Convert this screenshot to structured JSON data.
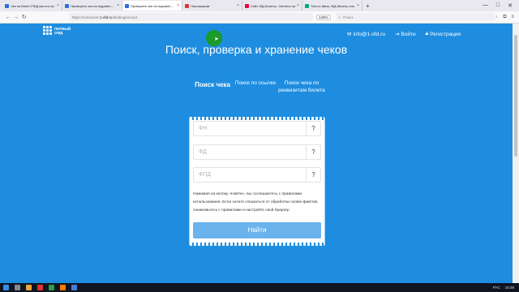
{
  "browser": {
    "tabs": [
      {
        "label": "Чек на билет РЖД как его на",
        "color": "#2a6fdb"
      },
      {
        "label": "Проверить чек на подлинность",
        "color": "#2a6fdb"
      },
      {
        "label": "Проверить чек на подлинность н",
        "color": "#2a6fdb",
        "active": true
      },
      {
        "label": "Пассажирам",
        "color": "#d33"
      },
      {
        "label": "Сайт ЖД Билеты - Билеты на",
        "color": "#e04"
      },
      {
        "label": "Tutu.ru Авиа, ЖД билеты онл",
        "color": "#0a7"
      }
    ],
    "new_tab": "+",
    "window_controls": [
      "—",
      "□",
      "✕"
    ],
    "url_prefix": "https://consumer.",
    "url_domain": "1-ofd.ru",
    "url_path": "/landing/receipt",
    "zoom": "140%",
    "search_placeholder": "Поиск"
  },
  "site": {
    "logo_line1": "ПЕРВЫЙ",
    "logo_line2": "ОФД",
    "nav": {
      "email": "info@1-ofd.ru",
      "login": "Войти",
      "register": "Регистрация"
    },
    "title": "Поиск, проверка и хранение чеков",
    "modes": [
      {
        "label": "Поиск чека",
        "active": true
      },
      {
        "label": "Поиск по ссылке"
      },
      {
        "label": "Поиск чека по реквизитам билета"
      }
    ],
    "form": {
      "fn_placeholder": "ФН",
      "fd_placeholder": "ФД",
      "fpd_placeholder": "ФПД",
      "help": "?",
      "notice": "Нажимая на кнопку «Найти», вы соглашаетесь с правилами использования. Если хотите отказаться от обработки cookie-файлов, ознакомьтесь с правилами и настройте свой браузер",
      "submit": "Найти"
    }
  },
  "taskbar": {
    "lang": "РУС",
    "time": "16:38"
  }
}
